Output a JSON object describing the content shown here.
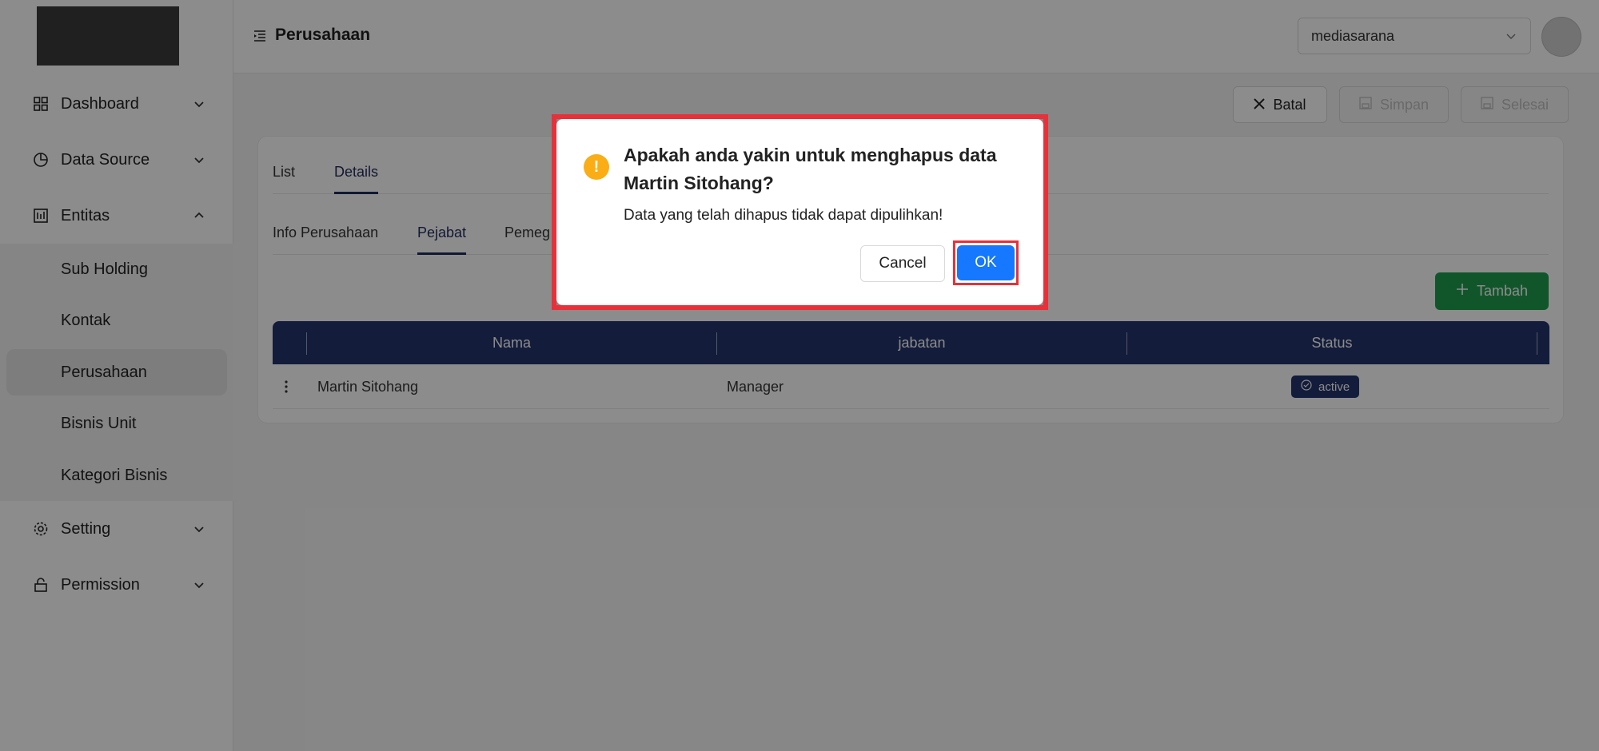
{
  "sidebar": {
    "items": [
      {
        "label": "Dashboard",
        "icon": "dashboard-icon"
      },
      {
        "label": "Data Source",
        "icon": "pie-chart-icon"
      },
      {
        "label": "Entitas",
        "icon": "entity-icon"
      },
      {
        "label": "Setting",
        "icon": "gear-icon"
      },
      {
        "label": "Permission",
        "icon": "lock-icon"
      }
    ],
    "entitas_sub": [
      "Sub Holding",
      "Kontak",
      "Perusahaan",
      "Bisnis Unit",
      "Kategori Bisnis"
    ]
  },
  "header": {
    "title": "Perusahaan",
    "company_select": "mediasarana"
  },
  "actions": {
    "batal": "Batal",
    "simpan": "Simpan",
    "selesai": "Selesai"
  },
  "tabs": [
    "List",
    "Details"
  ],
  "subtabs": [
    "Info Perusahaan",
    "Pejabat",
    "Pemeg"
  ],
  "tambah_label": "Tambah",
  "table": {
    "columns": [
      "Nama",
      "jabatan",
      "Status"
    ],
    "rows": [
      {
        "nama": "Martin Sitohang",
        "jabatan": "Manager",
        "status": "active"
      }
    ]
  },
  "modal": {
    "title": "Apakah anda yakin untuk menghapus data Martin Sitohang?",
    "content": "Data yang telah dihapus tidak dapat dipulihkan!",
    "cancel": "Cancel",
    "ok": "OK"
  },
  "colors": {
    "primary": "#24336b",
    "ok": "#1677ff",
    "highlight": "#e8303a",
    "tambah": "#1f9d4d",
    "warning": "#faad14"
  }
}
